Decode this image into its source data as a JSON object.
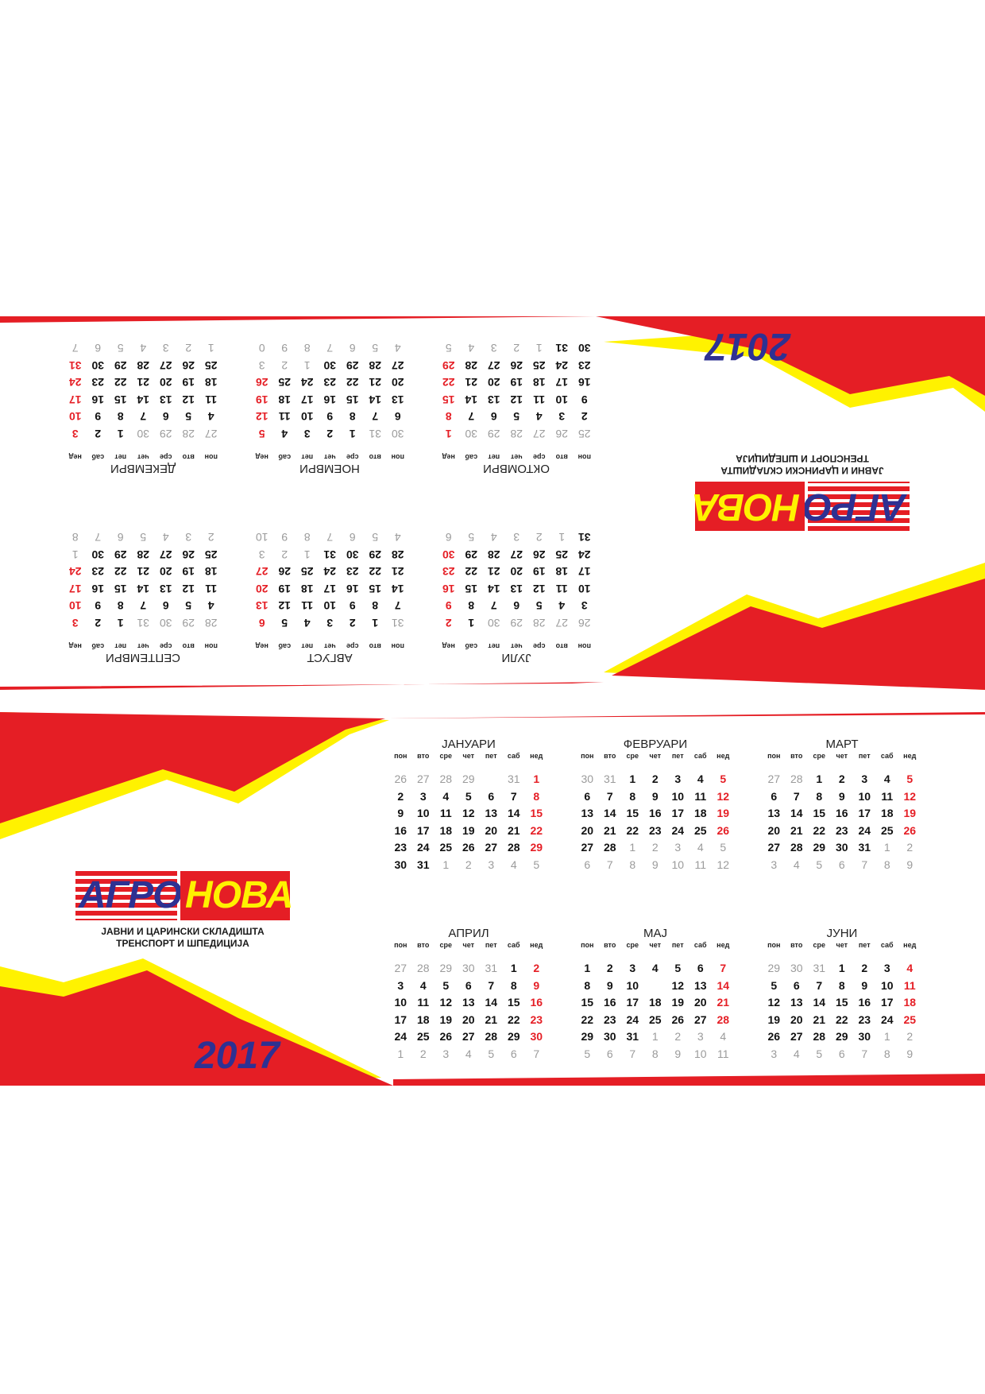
{
  "logo": {
    "left": "АГРО",
    "right": "НОВА"
  },
  "tagline": [
    "ЈАВНИ И ЦАРИНСКИ СКЛАДИШТА",
    "ТРЕНСПОРТ И ШПЕДИЦИЈА"
  ],
  "year": "2017",
  "weekdays": [
    "пон",
    "вто",
    "сре",
    "чет",
    "пет",
    "саб",
    "нед"
  ],
  "colors": {
    "red": "#e51e25",
    "yellow": "#fff200",
    "blue": "#2e3192",
    "gray": "#9b9b9b"
  },
  "top_panel_months": [
    {
      "name": "ЈУЛИ",
      "weeks": [
        [
          "26",
          "27",
          "28",
          "29",
          "30",
          "1",
          "2"
        ],
        [
          "3",
          "4",
          "5",
          "6",
          "7",
          "8",
          "9"
        ],
        [
          "10",
          "11",
          "12",
          "13",
          "14",
          "15",
          "16"
        ],
        [
          "17",
          "18",
          "19",
          "20",
          "21",
          "22",
          "23"
        ],
        [
          "24",
          "25",
          "26",
          "27",
          "28",
          "29",
          "30"
        ],
        [
          "31",
          "1",
          "2",
          "3",
          "4",
          "5",
          "6"
        ]
      ]
    },
    {
      "name": "АВГУСТ",
      "weeks": [
        [
          "31",
          "1",
          "2",
          "3",
          "4",
          "5",
          "6"
        ],
        [
          "7",
          "8",
          "9",
          "10",
          "11",
          "12",
          "13"
        ],
        [
          "14",
          "15",
          "16",
          "17",
          "18",
          "19",
          "20"
        ],
        [
          "21",
          "22",
          "23",
          "24",
          "25",
          "26",
          "27"
        ],
        [
          "28",
          "29",
          "30",
          "31",
          "1",
          "2",
          "3"
        ],
        [
          "4",
          "5",
          "6",
          "7",
          "8",
          "9",
          "10"
        ]
      ]
    },
    {
      "name": "СЕПТЕМВРИ",
      "weeks": [
        [
          "28",
          "29",
          "30",
          "31",
          "1",
          "2",
          "3"
        ],
        [
          "4",
          "5",
          "6",
          "7",
          "8",
          "9",
          "10"
        ],
        [
          "11",
          "12",
          "13",
          "14",
          "15",
          "16",
          "17"
        ],
        [
          "18",
          "19",
          "20",
          "21",
          "22",
          "23",
          "24"
        ],
        [
          "25",
          "26",
          "27",
          "28",
          "29",
          "30",
          "1"
        ],
        [
          "2",
          "3",
          "4",
          "5",
          "6",
          "7",
          "8"
        ]
      ]
    },
    {
      "name": "ОКТОМВРИ",
      "weeks": [
        [
          "25",
          "26",
          "27",
          "28",
          "29",
          "30",
          "1"
        ],
        [
          "2",
          "3",
          "4",
          "5",
          "6",
          "7",
          "8"
        ],
        [
          "9",
          "10",
          "11",
          "12",
          "13",
          "14",
          "15"
        ],
        [
          "16",
          "17",
          "18",
          "19",
          "20",
          "21",
          "22"
        ],
        [
          "23",
          "24",
          "25",
          "26",
          "27",
          "28",
          "29"
        ],
        [
          "30",
          "31",
          "1",
          "2",
          "3",
          "4",
          "5"
        ]
      ]
    },
    {
      "name": "НОЕМВРИ",
      "weeks": [
        [
          "30",
          "31",
          "1",
          "2",
          "3",
          "4",
          "5"
        ],
        [
          "6",
          "7",
          "8",
          "9",
          "10",
          "11",
          "12"
        ],
        [
          "13",
          "14",
          "15",
          "16",
          "17",
          "18",
          "19"
        ],
        [
          "20",
          "21",
          "22",
          "23",
          "24",
          "25",
          "26"
        ],
        [
          "27",
          "28",
          "29",
          "30",
          "1",
          "2",
          "3"
        ],
        [
          "4",
          "5",
          "6",
          "7",
          "8",
          "9",
          "0"
        ]
      ]
    },
    {
      "name": "ДЕКЕМВРИ",
      "weeks": [
        [
          "27",
          "28",
          "29",
          "30",
          "1",
          "2",
          "3"
        ],
        [
          "4",
          "5",
          "6",
          "7",
          "8",
          "9",
          "10"
        ],
        [
          "11",
          "12",
          "13",
          "14",
          "15",
          "16",
          "17"
        ],
        [
          "18",
          "19",
          "20",
          "21",
          "22",
          "23",
          "24"
        ],
        [
          "25",
          "26",
          "27",
          "28",
          "29",
          "30",
          "31"
        ],
        [
          "1",
          "2",
          "3",
          "4",
          "5",
          "6",
          "7"
        ]
      ]
    }
  ],
  "bottom_panel_months": [
    {
      "name": "ЈАНУАРИ",
      "weeks": [
        [
          "26",
          "27",
          "28",
          "29",
          "",
          "31",
          "1"
        ],
        [
          "2",
          "3",
          "4",
          "5",
          "6",
          "7",
          "8"
        ],
        [
          "9",
          "10",
          "11",
          "12",
          "13",
          "14",
          "15"
        ],
        [
          "16",
          "17",
          "18",
          "19",
          "20",
          "21",
          "22"
        ],
        [
          "23",
          "24",
          "25",
          "26",
          "27",
          "28",
          "29"
        ],
        [
          "30",
          "31",
          "1",
          "2",
          "3",
          "4",
          "5"
        ]
      ]
    },
    {
      "name": "ФЕВРУАРИ",
      "weeks": [
        [
          "30",
          "31",
          "1",
          "2",
          "3",
          "4",
          "5"
        ],
        [
          "6",
          "7",
          "8",
          "9",
          "10",
          "11",
          "12"
        ],
        [
          "13",
          "14",
          "15",
          "16",
          "17",
          "18",
          "19"
        ],
        [
          "20",
          "21",
          "22",
          "23",
          "24",
          "25",
          "26"
        ],
        [
          "27",
          "28",
          "1",
          "2",
          "3",
          "4",
          "5"
        ],
        [
          "6",
          "7",
          "8",
          "9",
          "10",
          "11",
          "12"
        ]
      ]
    },
    {
      "name": "МАРТ",
      "weeks": [
        [
          "27",
          "28",
          "1",
          "2",
          "3",
          "4",
          "5"
        ],
        [
          "6",
          "7",
          "8",
          "9",
          "10",
          "11",
          "12"
        ],
        [
          "13",
          "14",
          "15",
          "16",
          "17",
          "18",
          "19"
        ],
        [
          "20",
          "21",
          "22",
          "23",
          "24",
          "25",
          "26"
        ],
        [
          "27",
          "28",
          "29",
          "30",
          "31",
          "1",
          "2"
        ],
        [
          "3",
          "4",
          "5",
          "6",
          "7",
          "8",
          "9"
        ]
      ]
    },
    {
      "name": "АПРИЛ",
      "weeks": [
        [
          "27",
          "28",
          "29",
          "30",
          "31",
          "1",
          "2"
        ],
        [
          "3",
          "4",
          "5",
          "6",
          "7",
          "8",
          "9"
        ],
        [
          "10",
          "11",
          "12",
          "13",
          "14",
          "15",
          "16"
        ],
        [
          "17",
          "18",
          "19",
          "20",
          "21",
          "22",
          "23"
        ],
        [
          "24",
          "25",
          "26",
          "27",
          "28",
          "29",
          "30"
        ],
        [
          "1",
          "2",
          "3",
          "4",
          "5",
          "6",
          "7"
        ]
      ]
    },
    {
      "name": "МАЈ",
      "weeks": [
        [
          "1",
          "2",
          "3",
          "4",
          "5",
          "6",
          "7"
        ],
        [
          "8",
          "9",
          "10",
          "",
          "12",
          "13",
          "14"
        ],
        [
          "15",
          "16",
          "17",
          "18",
          "19",
          "20",
          "21"
        ],
        [
          "22",
          "23",
          "24",
          "25",
          "26",
          "27",
          "28"
        ],
        [
          "29",
          "30",
          "31",
          "1",
          "2",
          "3",
          "4"
        ],
        [
          "5",
          "6",
          "7",
          "8",
          "9",
          "10",
          "11"
        ]
      ]
    },
    {
      "name": "ЈУНИ",
      "weeks": [
        [
          "29",
          "30",
          "31",
          "1",
          "2",
          "3",
          "4"
        ],
        [
          "5",
          "6",
          "7",
          "8",
          "9",
          "10",
          "11"
        ],
        [
          "12",
          "13",
          "14",
          "15",
          "16",
          "17",
          "18"
        ],
        [
          "19",
          "20",
          "21",
          "22",
          "23",
          "24",
          "25"
        ],
        [
          "26",
          "27",
          "28",
          "29",
          "30",
          "1",
          "2"
        ],
        [
          "3",
          "4",
          "5",
          "6",
          "7",
          "8",
          "9"
        ]
      ]
    }
  ]
}
